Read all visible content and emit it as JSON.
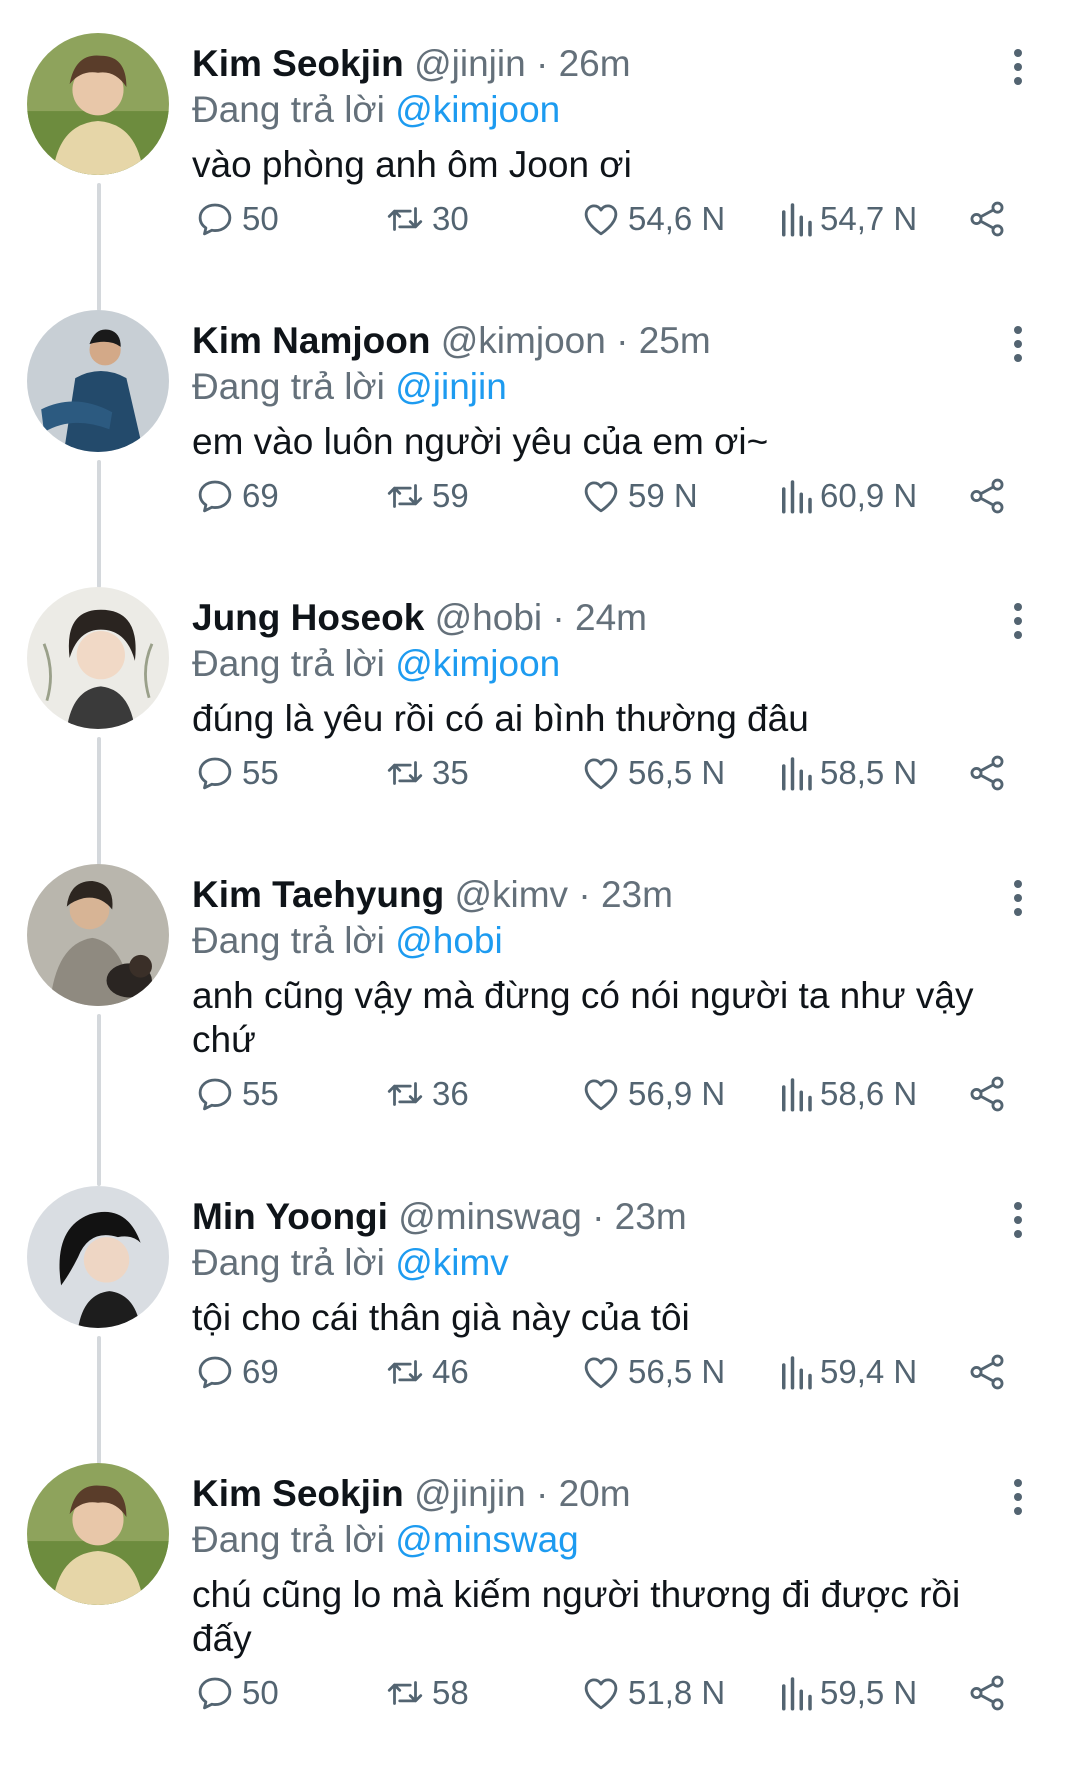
{
  "colors": {
    "mention": "#1d9bf0",
    "muted": "#64707a",
    "text": "#0f1419",
    "thread_line": "#d4d8dc"
  },
  "icons": {
    "reply": "comment-bubble-icon",
    "retweet": "retweet-arrows-icon",
    "like": "heart-icon",
    "views": "bar-chart-icon",
    "share": "share-icon",
    "more": "more-vertical-icon"
  },
  "tweets": [
    {
      "name": "Kim Seokjin",
      "handle": "@jinjin",
      "sep": "·",
      "time": "26m",
      "reply_prefix": "Đang trả lời",
      "reply_to": "@kimjoon",
      "text": "vào phòng anh ôm Joon ơi",
      "replies": "50",
      "retweets": "30",
      "likes": "54,6 N",
      "views": "54,7 N",
      "avatar": "avatar-jin"
    },
    {
      "name": "Kim Namjoon",
      "handle": "@kimjoon",
      "sep": "·",
      "time": "25m",
      "reply_prefix": "Đang trả lời",
      "reply_to": "@jinjin",
      "text": "em vào luôn người yêu của em ơi~",
      "replies": "69",
      "retweets": "59",
      "likes": "59 N",
      "views": "60,9 N",
      "avatar": "avatar-namjoon"
    },
    {
      "name": "Jung Hoseok",
      "handle": "@hobi",
      "sep": "·",
      "time": "24m",
      "reply_prefix": "Đang trả lời",
      "reply_to": "@kimjoon",
      "text": "đúng là yêu rồi có ai bình thường đâu",
      "replies": "55",
      "retweets": "35",
      "likes": "56,5 N",
      "views": "58,5 N",
      "avatar": "avatar-hoseok"
    },
    {
      "name": "Kim Taehyung",
      "handle": "@kimv",
      "sep": "·",
      "time": "23m",
      "reply_prefix": "Đang trả lời",
      "reply_to": "@hobi",
      "text": "anh cũng vậy mà đừng có nói người ta như vậy chứ",
      "replies": "55",
      "retweets": "36",
      "likes": "56,9 N",
      "views": "58,6 N",
      "avatar": "avatar-taehyung"
    },
    {
      "name": "Min Yoongi",
      "handle": "@minswag",
      "sep": "·",
      "time": "23m",
      "reply_prefix": "Đang trả lời",
      "reply_to": "@kimv",
      "text": "tội cho cái thân già này của tôi",
      "replies": "69",
      "retweets": "46",
      "likes": "56,5 N",
      "views": "59,4 N",
      "avatar": "avatar-yoongi"
    },
    {
      "name": "Kim Seokjin",
      "handle": "@jinjin",
      "sep": "·",
      "time": "20m",
      "reply_prefix": "Đang trả lời",
      "reply_to": "@minswag",
      "text": "chú cũng lo mà kiếm người thương đi được rồi đấy",
      "replies": "50",
      "retweets": "58",
      "likes": "51,8 N",
      "views": "59,5 N",
      "avatar": "avatar-jin"
    }
  ]
}
